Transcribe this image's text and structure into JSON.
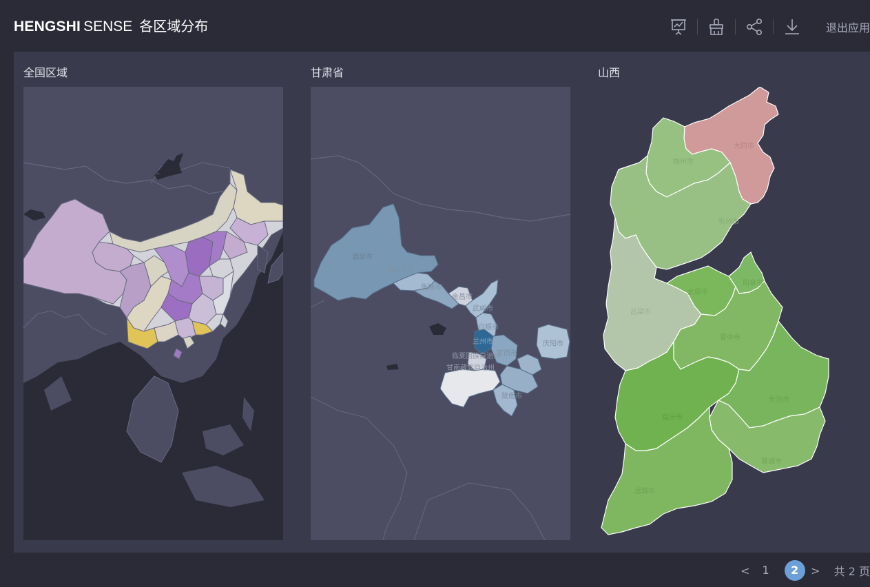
{
  "header": {
    "brand_bold": "HENGSHI",
    "brand_light": "SENSE",
    "title": "各区域分布",
    "exit_label": "退出应用"
  },
  "panels": [
    {
      "title": "全国区域"
    },
    {
      "title": "甘肃省",
      "labels": [
        "酒泉市",
        "嘉峪关市",
        "张掖市",
        "金昌市",
        "武威市",
        "白银市",
        "兰州市",
        "定西市",
        "临夏回族自治州",
        "甘南藏族自治州",
        "陇南市",
        "庆阳市"
      ]
    },
    {
      "title": "山西",
      "labels": [
        "大同市",
        "朔州市",
        "忻州市",
        "阳泉市",
        "太原市",
        "晋中市",
        "吕梁市",
        "长治市",
        "临汾市",
        "晋城市",
        "运城市"
      ]
    }
  ],
  "pagination": {
    "prev": "<",
    "pages": [
      "1",
      "2"
    ],
    "current": "2",
    "next": ">",
    "total": "共 2 页"
  },
  "colors": {
    "background": "#2b2b38",
    "board": "#393a4b",
    "map_water": "#4c4d63",
    "pager_active": "#6d9fd9"
  },
  "icons": [
    "presentation-icon",
    "brush-icon",
    "share-icon",
    "download-icon"
  ]
}
